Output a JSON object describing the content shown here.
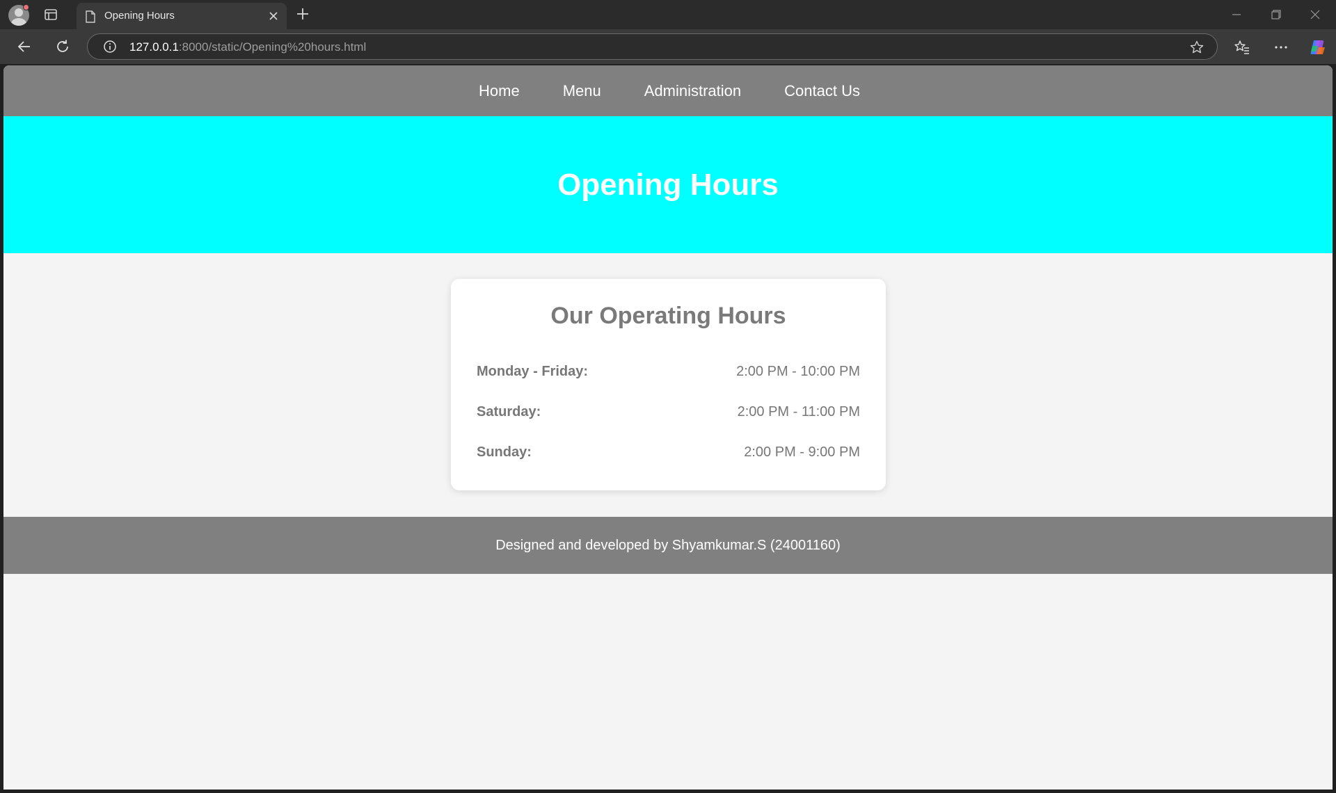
{
  "browser": {
    "tab_title": "Opening Hours",
    "url_host": "127.0.0.1",
    "url_path": ":8000/static/Opening%20hours.html"
  },
  "nav": {
    "items": [
      "Home",
      "Menu",
      "Administration",
      "Contact Us"
    ]
  },
  "hero": {
    "title": "Opening Hours"
  },
  "hours": {
    "heading": "Our Operating Hours",
    "rows": [
      {
        "day": "Monday - Friday:",
        "time": "2:00 PM - 10:00 PM"
      },
      {
        "day": "Saturday:",
        "time": "2:00 PM - 11:00 PM"
      },
      {
        "day": "Sunday:",
        "time": "2:00 PM - 9:00 PM"
      }
    ]
  },
  "footer": {
    "text": "Designed and developed by Shyamkumar.S (24001160)"
  },
  "colors": {
    "nav_bg": "#808080",
    "hero_bg": "#00ffff",
    "page_bg": "#f4f4f4",
    "card_bg": "#ffffff",
    "text_gray": "#777777"
  },
  "icons": [
    "profile-icon",
    "tab-actions-icon",
    "page-icon",
    "close-icon",
    "plus-icon",
    "minimize-icon",
    "restore-icon",
    "back-arrow-icon",
    "reload-icon",
    "info-icon",
    "star-icon",
    "favorites-icon",
    "more-icon",
    "copilot-icon"
  ]
}
